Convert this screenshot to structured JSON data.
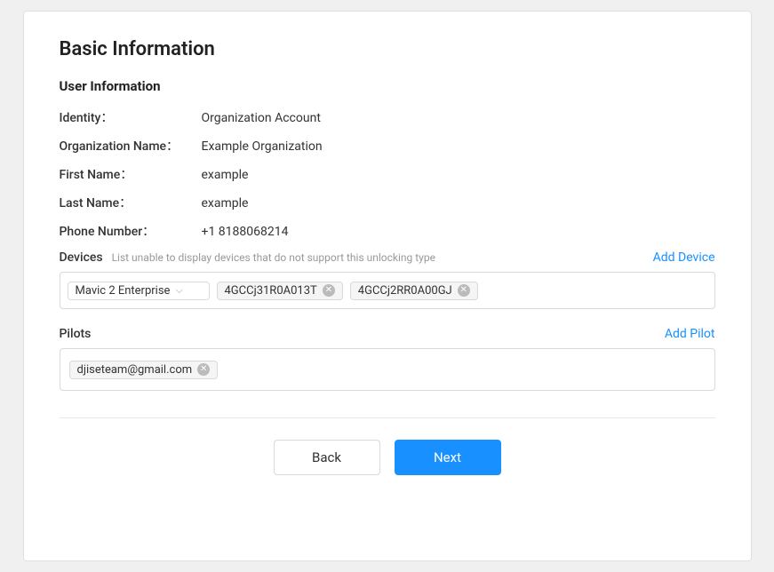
{
  "page": {
    "title": "Basic Information",
    "section_title": "User Information",
    "identity_label": "Identity：",
    "identity_value": "Organization Account",
    "org_name_label": "Organization Name：",
    "org_name_value": "Example Organization",
    "first_name_label": "First Name：",
    "first_name_value": "example",
    "last_name_label": "Last Name：",
    "last_name_value": "example",
    "phone_label": "Phone Number：",
    "phone_value": "+1 8188068214",
    "devices_label": "Devices",
    "devices_hint": "List unable to display devices that do not support this unlocking type",
    "add_device_label": "Add Device",
    "device_dropdown_value": "Mavic 2 Enterprise",
    "device_tags": [
      {
        "id": "tag1",
        "value": "4GCCj31R0A013T"
      },
      {
        "id": "tag2",
        "value": "4GCCj2RR0A00GJ"
      }
    ],
    "pilots_label": "Pilots",
    "add_pilot_label": "Add Pilot",
    "pilot_tags": [
      {
        "id": "pilot1",
        "value": "djiseteam@gmail.com"
      }
    ],
    "back_button": "Back",
    "next_button": "Next"
  }
}
